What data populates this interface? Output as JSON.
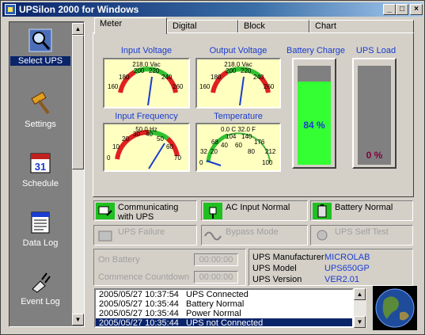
{
  "window": {
    "title": "UPSilon 2000 for Windows",
    "buttons": [
      "_",
      "□",
      "×"
    ]
  },
  "nav": {
    "items": [
      {
        "label": "Select UPS",
        "icon": "magnifier-icon",
        "selected": true
      },
      {
        "label": "Settings",
        "icon": "hammer-icon"
      },
      {
        "label": "Schedule",
        "icon": "calendar-icon",
        "badge": "31"
      },
      {
        "label": "Data Log",
        "icon": "document-icon"
      },
      {
        "label": "Event Log",
        "icon": "plug-icon"
      }
    ]
  },
  "tabs": [
    "Meter",
    "Digital",
    "Block",
    "Chart"
  ],
  "meters": {
    "input_voltage": {
      "title": "Input Voltage",
      "reading": "218.0 Vac",
      "ticks": [
        "160",
        "180",
        "200",
        "220",
        "240",
        "260"
      ]
    },
    "output_voltage": {
      "title": "Output Voltage",
      "reading": "218.0 Vac",
      "ticks": [
        "160",
        "180",
        "200",
        "220",
        "240",
        "260"
      ]
    },
    "input_frequency": {
      "title": "Input Frequency",
      "reading": "50.0 Hz",
      "ticks": [
        "0",
        "10",
        "20",
        "30",
        "40",
        "50",
        "60",
        "70"
      ]
    },
    "temperature": {
      "title": "Temperature",
      "reading": "0.0 C   32.0 F",
      "ticks": [
        "32",
        "68",
        "104",
        "140",
        "176",
        "212",
        "0",
        "20",
        "40",
        "60",
        "80",
        "100"
      ]
    }
  },
  "battery_charge": {
    "title": "Battery Charge",
    "value": "84 %",
    "level": 0.84,
    "color": "#33ff33"
  },
  "ups_load": {
    "title": "UPS Load",
    "value": "0 %",
    "level": 0.0,
    "color": "#800040"
  },
  "status": [
    {
      "text": "Communicating with UPS",
      "icon": "communication-icon",
      "active": true
    },
    {
      "text": "AC Input Normal",
      "icon": "plug-icon",
      "active": true
    },
    {
      "text": "Battery Normal",
      "icon": "battery-icon",
      "active": true
    },
    {
      "text": "UPS Failure",
      "icon": "ups-failure-icon",
      "active": false
    },
    {
      "text": "Bypass Mode",
      "icon": "bypass-wave-icon",
      "active": false
    },
    {
      "text": "UPS Self Test",
      "icon": "self-test-icon",
      "active": false
    }
  ],
  "timers": {
    "on_battery": {
      "label": "On Battery",
      "value": "00:00:00"
    },
    "commence": {
      "label": "Commence Countdown",
      "value": "00:00:00"
    }
  },
  "ups_info": [
    {
      "label": "UPS Manufacturer",
      "value": "MICROLAB"
    },
    {
      "label": "UPS Model",
      "value": "UPS650GP"
    },
    {
      "label": "UPS Version",
      "value": "VER2.01"
    }
  ],
  "log": [
    {
      "ts": "2005/05/27 10:37:54",
      "msg": "UPS Connected"
    },
    {
      "ts": "2005/05/27 10:35:44",
      "msg": "Battery Normal"
    },
    {
      "ts": "2005/05/27 10:35:44",
      "msg": "Power Normal"
    },
    {
      "ts": "2005/05/27 10:35:44",
      "msg": "UPS not Connected",
      "selected": true
    }
  ],
  "colors": {
    "accent": "#1a3cd0",
    "title_bar": "#0a246a",
    "panel": "#d4d0c8"
  }
}
